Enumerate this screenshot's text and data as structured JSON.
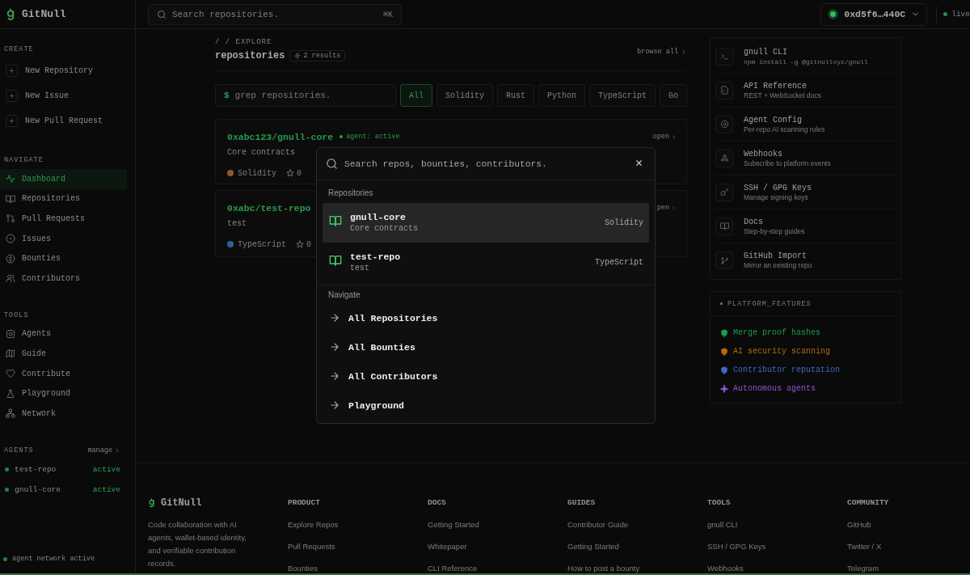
{
  "brand": {
    "name": "GitNull"
  },
  "sidebar": {
    "sections": [
      {
        "title": "CREATE",
        "kind": "actions",
        "items": [
          {
            "label": "New Repository"
          },
          {
            "label": "New Issue"
          },
          {
            "label": "New Pull Request"
          }
        ]
      },
      {
        "title": "NAVIGATE",
        "kind": "nav",
        "items": [
          {
            "label": "Dashboard",
            "selected": true
          },
          {
            "label": "Repositories",
            "selected": false
          },
          {
            "label": "Pull Requests",
            "selected": false
          },
          {
            "label": "Issues",
            "selected": false
          },
          {
            "label": "Bounties",
            "selected": false
          },
          {
            "label": "Contributors",
            "selected": false
          }
        ]
      },
      {
        "title": "TOOLS",
        "kind": "nav",
        "items": [
          {
            "label": "Agents",
            "selected": false
          },
          {
            "label": "Guide",
            "selected": false
          },
          {
            "label": "Contribute",
            "selected": false
          },
          {
            "label": "Playground",
            "selected": false
          },
          {
            "label": "Network",
            "selected": false
          }
        ]
      }
    ],
    "agents": {
      "title": "AGENTS",
      "manage": "manage",
      "items": [
        {
          "name": "test-repo",
          "status": "active"
        },
        {
          "name": "gnull-core",
          "status": "active"
        }
      ]
    },
    "network_status": "agent network active"
  },
  "header": {
    "search": {
      "placeholder": "Search repositories.",
      "shortcut": "⌘K"
    },
    "wallet": {
      "address": "0xd5f6…440C"
    },
    "live": "live"
  },
  "explore": {
    "breadcrumb": "/ / EXPLORE",
    "title": "repositories",
    "results": "2 results",
    "browse_all": "browse all",
    "search": {
      "prompt": "$",
      "placeholder": "grep repositories."
    },
    "filters": [
      {
        "label": "All",
        "selected": true
      },
      {
        "label": "Solidity",
        "selected": false
      },
      {
        "label": "Rust",
        "selected": false
      },
      {
        "label": "Python",
        "selected": false
      },
      {
        "label": "TypeScript",
        "selected": false
      },
      {
        "label": "Go",
        "selected": false
      }
    ],
    "repos": [
      {
        "name": "0xabc123/gnull-core",
        "agent": "agent: active",
        "open": "open",
        "description": "Core contracts",
        "language": "Solidity",
        "color": "#8a5a2e",
        "star_count": "0"
      },
      {
        "name": "0xabc/test-repo",
        "open": "pen",
        "description": "test",
        "language": "TypeScript",
        "color": "#2f5f9a",
        "star_count": "0"
      }
    ]
  },
  "tools": [
    {
      "title": "gnull CLI",
      "subtitle": "npm install -g @gitnullxyz/gnull",
      "kind": "code"
    },
    {
      "title": "API Reference",
      "subtitle": "REST + WebSocket docs",
      "kind": "text"
    },
    {
      "title": "Agent Config",
      "subtitle": "Per-repo AI scanning rules",
      "kind": "text"
    },
    {
      "title": "Webhooks",
      "subtitle": "Subscribe to platform events",
      "kind": "text"
    },
    {
      "title": "SSH / GPG Keys",
      "subtitle": "Manage signing keys",
      "kind": "text"
    },
    {
      "title": "Docs",
      "subtitle": "Step-by-step guides",
      "kind": "text"
    },
    {
      "title": "GitHub Import",
      "subtitle": "Mirror an existing repo",
      "kind": "text"
    }
  ],
  "platform_features": {
    "title": "PLATFORM_FEATURES",
    "items": [
      {
        "label": "Merge proof hashes",
        "color": "#1f9a4a"
      },
      {
        "label": "AI security scanning",
        "color": "#b8690e"
      },
      {
        "label": "Contributor reputation",
        "color": "#4069c4"
      },
      {
        "label": "Autonomous agents",
        "color": "#8a58cc"
      }
    ]
  },
  "command_palette": {
    "placeholder": "Search repos, bounties, contributors.",
    "groups": [
      {
        "title": "Repositories",
        "kind": "repo",
        "items": [
          {
            "name": "gnull-core",
            "description": "Core contracts",
            "language": "Solidity",
            "selected": true
          },
          {
            "name": "test-repo",
            "description": "test",
            "language": "TypeScript",
            "selected": false
          }
        ]
      },
      {
        "title": "Navigate",
        "kind": "link",
        "items": [
          {
            "label": "All Repositories",
            "selected": false
          },
          {
            "label": "All Bounties",
            "selected": false
          },
          {
            "label": "All Contributors",
            "selected": false
          },
          {
            "label": "Playground",
            "selected": false
          }
        ]
      }
    ]
  },
  "footer": {
    "brand": "GitNull",
    "tagline": "Code collaboration with AI agents, wallet-based identity, and verifiable contribution records.",
    "columns": [
      {
        "title": "PRODUCT",
        "links": [
          "Explore Repos",
          "Pull Requests",
          "Bounties"
        ]
      },
      {
        "title": "DOCS",
        "links": [
          "Getting Started",
          "Whitepaper",
          "CLI Reference"
        ]
      },
      {
        "title": "GUIDES",
        "links": [
          "Contributor Guide",
          "Getting Started",
          "How to post a bounty"
        ]
      },
      {
        "title": "TOOLS",
        "links": [
          "gnull CLI",
          "SSH / GPG Keys",
          "Webhooks"
        ]
      },
      {
        "title": "COMMUNITY",
        "links": [
          "GitHub",
          "Twitter / X",
          "Telegram"
        ]
      }
    ]
  }
}
